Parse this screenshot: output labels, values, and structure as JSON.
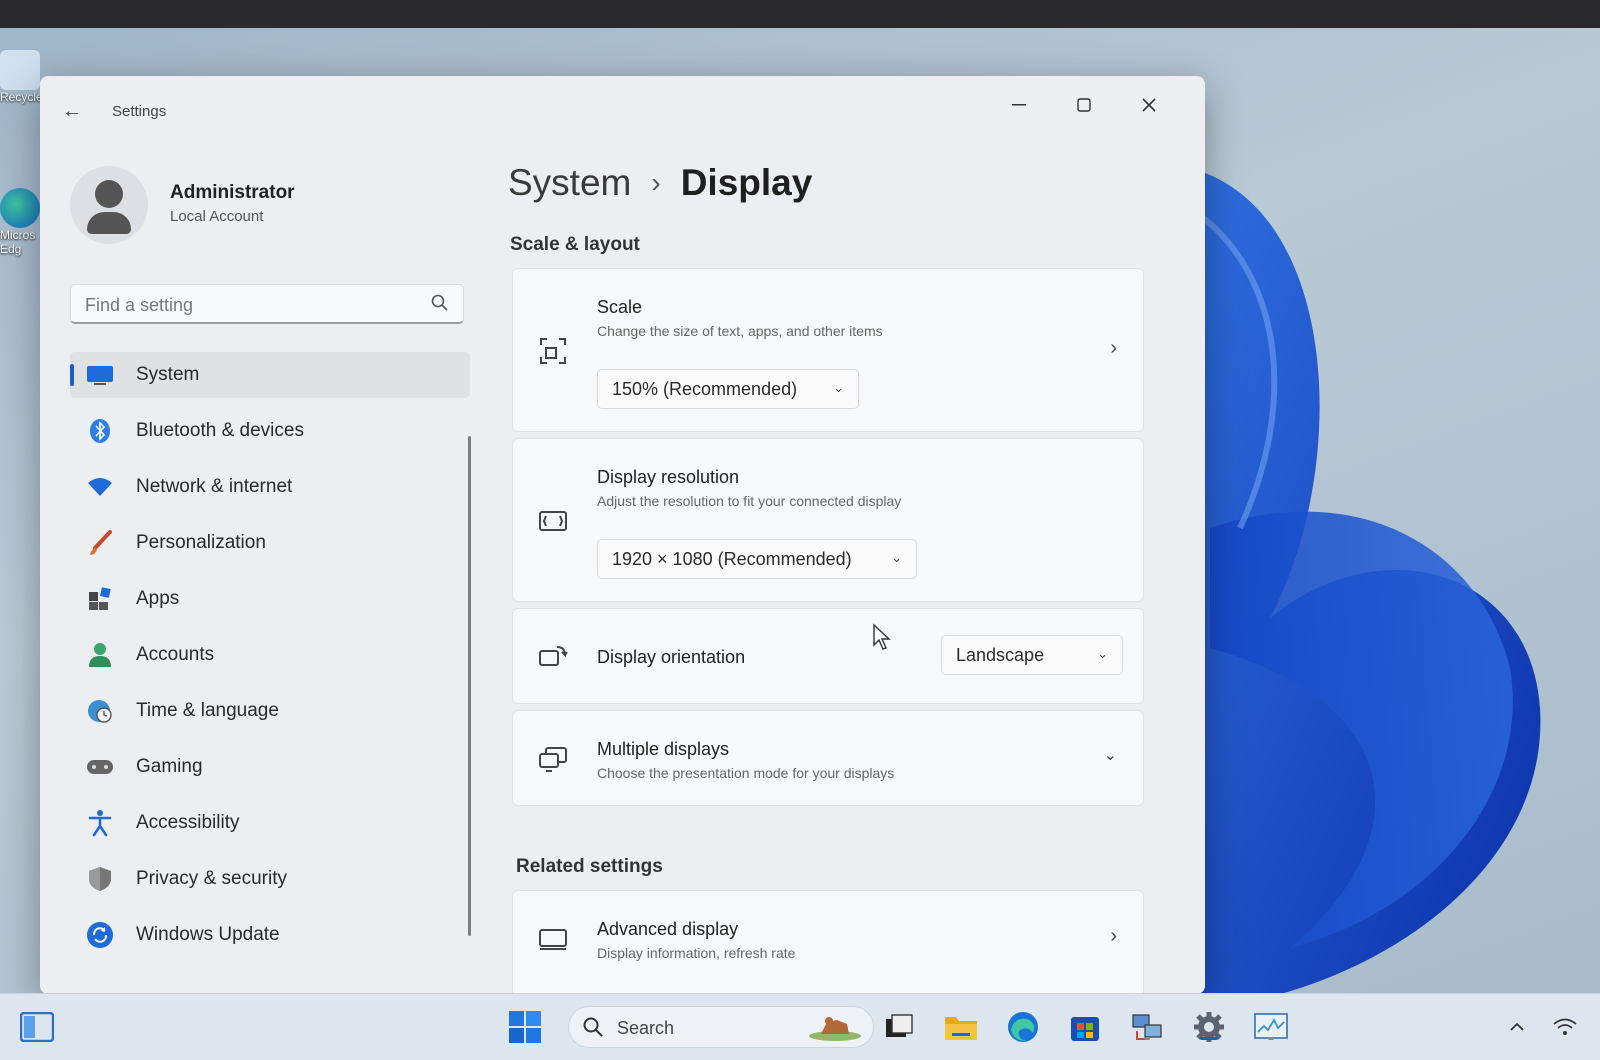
{
  "window": {
    "app_title": "Settings"
  },
  "profile": {
    "name": "Administrator",
    "account_type": "Local Account"
  },
  "search": {
    "placeholder": "Find a setting"
  },
  "nav": {
    "items": [
      {
        "label": "System",
        "icon": "system-icon",
        "active": true
      },
      {
        "label": "Bluetooth & devices",
        "icon": "bluetooth-icon"
      },
      {
        "label": "Network & internet",
        "icon": "wifi-icon"
      },
      {
        "label": "Personalization",
        "icon": "brush-icon"
      },
      {
        "label": "Apps",
        "icon": "apps-icon"
      },
      {
        "label": "Accounts",
        "icon": "accounts-icon"
      },
      {
        "label": "Time & language",
        "icon": "globe-clock-icon"
      },
      {
        "label": "Gaming",
        "icon": "gamepad-icon"
      },
      {
        "label": "Accessibility",
        "icon": "accessibility-icon"
      },
      {
        "label": "Privacy & security",
        "icon": "shield-icon"
      },
      {
        "label": "Windows Update",
        "icon": "update-icon"
      }
    ]
  },
  "breadcrumb": {
    "parent": "System",
    "separator": "›",
    "current": "Display"
  },
  "sections": {
    "scale_layout": "Scale & layout",
    "related": "Related settings"
  },
  "cards": {
    "scale": {
      "title": "Scale",
      "subtitle": "Change the size of text, apps, and other items",
      "value": "150% (Recommended)"
    },
    "resolution": {
      "title": "Display resolution",
      "subtitle": "Adjust the resolution to fit your connected display",
      "value": "1920 × 1080 (Recommended)"
    },
    "orientation": {
      "title": "Display orientation",
      "value": "Landscape"
    },
    "multiple": {
      "title": "Multiple displays",
      "subtitle": "Choose the presentation mode for your displays"
    },
    "advanced": {
      "title": "Advanced display",
      "subtitle": "Display information, refresh rate"
    }
  },
  "desktop": {
    "recycle_label": "Recycle",
    "edge_label": "Micros Edg"
  },
  "taskbar": {
    "search_label": "Search"
  },
  "colors": {
    "accent": "#1a5fc8",
    "window_bg": "#eceef1",
    "card_bg": "#f7f8f9"
  }
}
